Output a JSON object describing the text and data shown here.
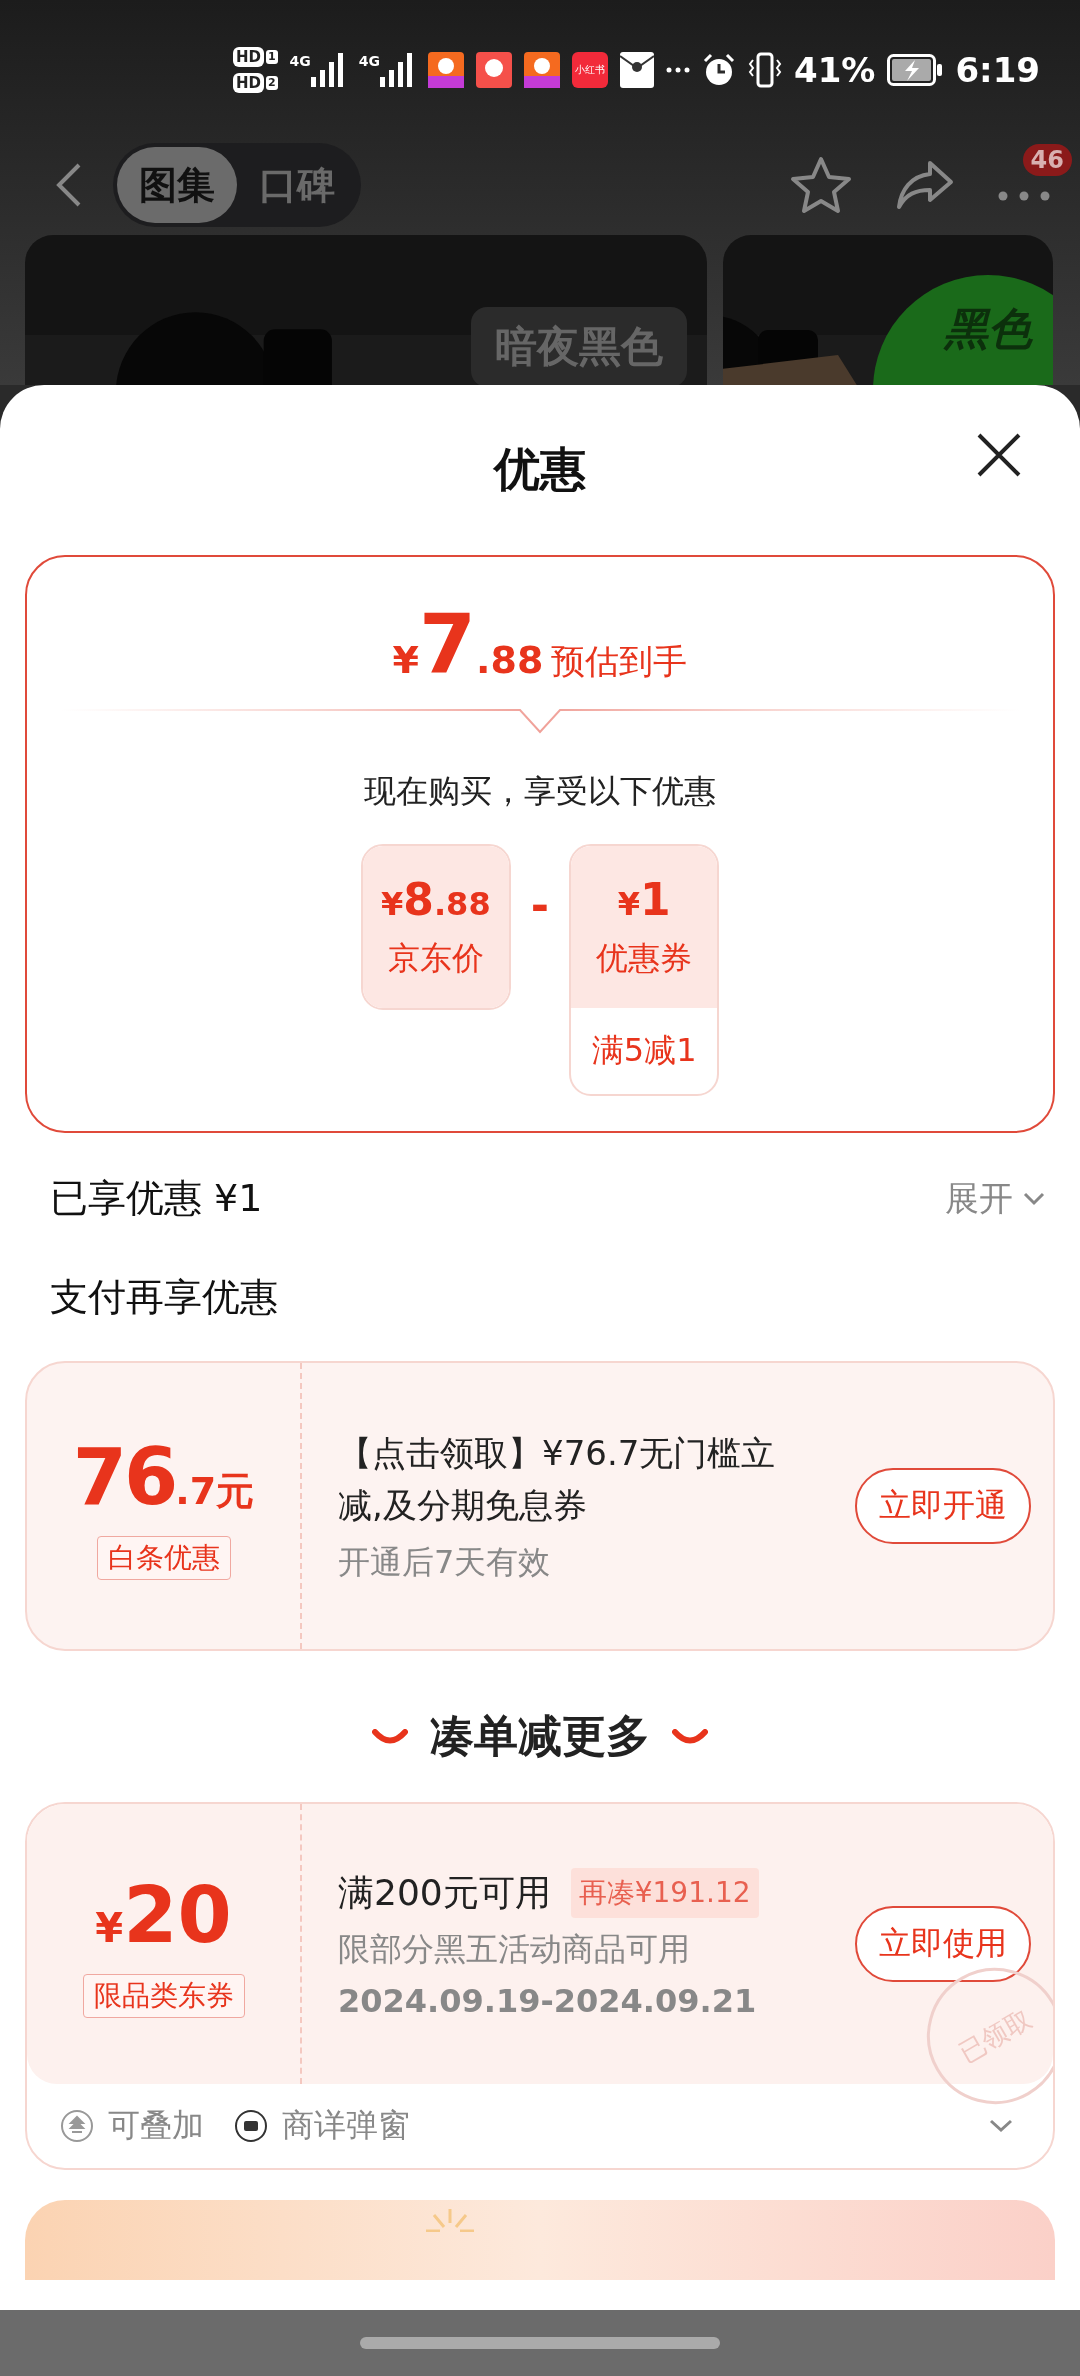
{
  "status_bar": {
    "sims": [
      {
        "label": "HD",
        "slot": "1",
        "network": "4G"
      },
      {
        "label": "HD",
        "slot": "2",
        "network": "4G"
      }
    ],
    "app_badge": "小红书",
    "battery": "41%",
    "time": "6:19"
  },
  "header": {
    "tabs": [
      {
        "label": "图集",
        "selected": true
      },
      {
        "label": "口碑",
        "selected": false
      }
    ],
    "more_badge": "46"
  },
  "gallery": [
    {
      "kind": "picture",
      "label": "暗夜黑色"
    },
    {
      "kind": "picture",
      "badge": "黑色"
    }
  ],
  "sheet": {
    "title": "优惠",
    "estimate": {
      "currency": "¥",
      "integer": "7",
      "decimal": ".88",
      "label": "预估到手"
    },
    "subtitle": "现在购买，享受以下优惠",
    "breakdown": [
      {
        "currency": "¥",
        "integer": "8",
        "decimal": ".88",
        "label": "京东价"
      },
      {
        "currency": "¥",
        "integer": "1",
        "label": "优惠券",
        "condition": "满5减1"
      }
    ],
    "operator": "-",
    "enjoyed": {
      "label": "已享优惠 ¥1",
      "expand": "展开"
    },
    "pay_section": {
      "title": "支付再享优惠",
      "offer": {
        "integer": "76",
        "decimal": ".7元",
        "tag": "白条优惠",
        "title": "【点击领取】¥76.7无门槛立减,及分期免息券",
        "note": "开通后7天有效",
        "button": "立即开通"
      }
    },
    "more_section": {
      "title": "凑单减更多",
      "coupon": {
        "currency": "¥",
        "amount": "20",
        "tag": "限品类东券",
        "title": "满200元可用",
        "extra": "再凑¥191.12",
        "desc": "限部分黑五活动商品可用",
        "dates": "2024.09.19-2024.09.21",
        "button": "立即使用",
        "stamp": "已领取",
        "features": [
          {
            "kind": "stack",
            "label": "可叠加"
          },
          {
            "kind": "popup",
            "label": "商详弹窗"
          }
        ]
      }
    }
  }
}
